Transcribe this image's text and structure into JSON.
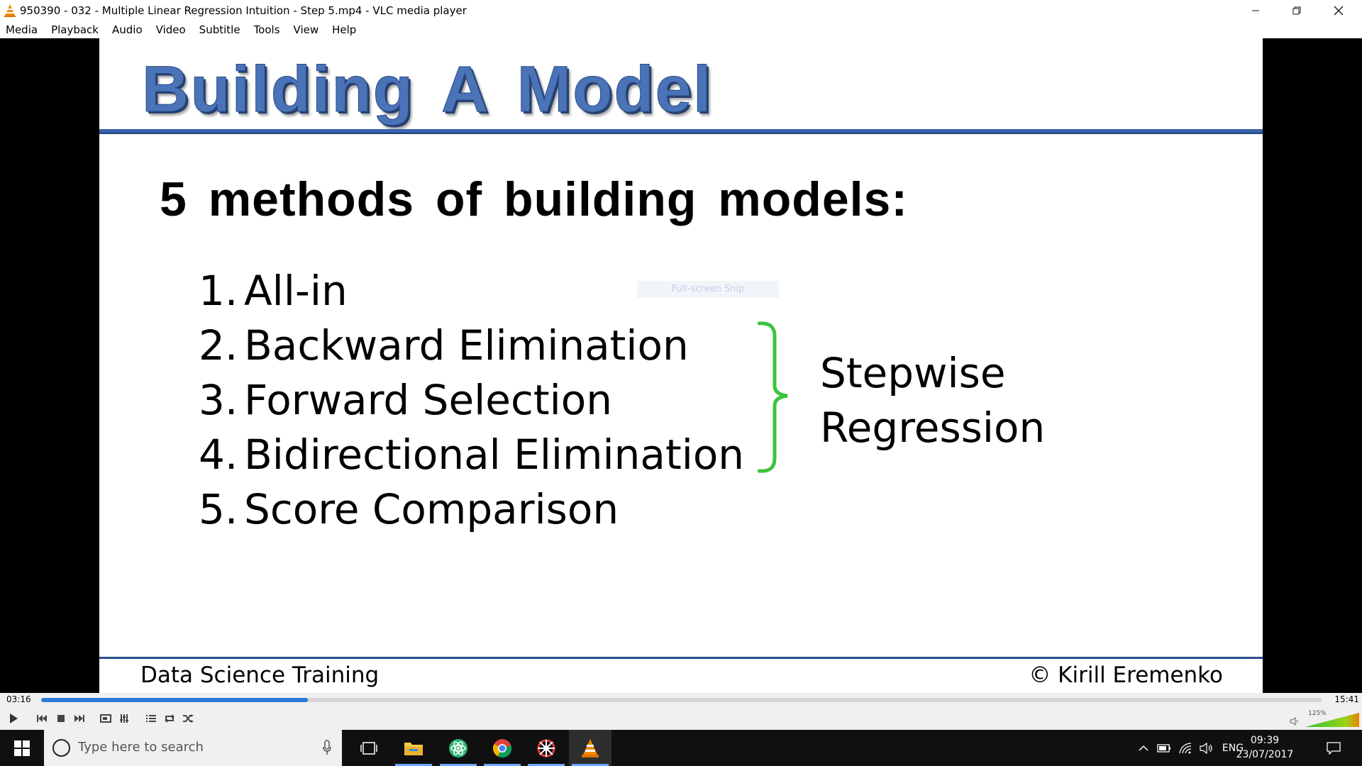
{
  "window": {
    "title": "950390 - 032 - Multiple Linear Regression Intuition - Step 5.mp4 - VLC media player",
    "icon": "vlc-cone-icon"
  },
  "menu": [
    "Media",
    "Playback",
    "Audio",
    "Video",
    "Subtitle",
    "Tools",
    "View",
    "Help"
  ],
  "slide": {
    "title": "Building A Model",
    "subtitle": "5 methods of building models:",
    "methods": [
      {
        "num": "1.",
        "label": "All-in"
      },
      {
        "num": "2.",
        "label": "Backward Elimination"
      },
      {
        "num": "3.",
        "label": "Forward Selection"
      },
      {
        "num": "4.",
        "label": "Bidirectional Elimination"
      },
      {
        "num": "5.",
        "label": "Score Comparison"
      }
    ],
    "group_label_line1": "Stepwise",
    "group_label_line2": "Regression",
    "brace_color": "#3cc43c",
    "footer_left": "Data Science Training",
    "footer_right": "© Kirill Eremenko",
    "overlay_text": "Full-screen Snip",
    "title_color": "#4a73b8"
  },
  "player": {
    "current_time": "03:16",
    "total_time": "15:41",
    "progress_fraction": 0.208,
    "volume_label": "125%",
    "accent": "#2a7bd6"
  },
  "taskbar": {
    "search_placeholder": "Type here to search",
    "language": "ENG",
    "time": "09:39",
    "date": "23/07/2017",
    "apps": [
      "file-explorer-icon",
      "atom-icon",
      "chrome-icon",
      "settings-app-icon",
      "vlc-icon"
    ]
  }
}
